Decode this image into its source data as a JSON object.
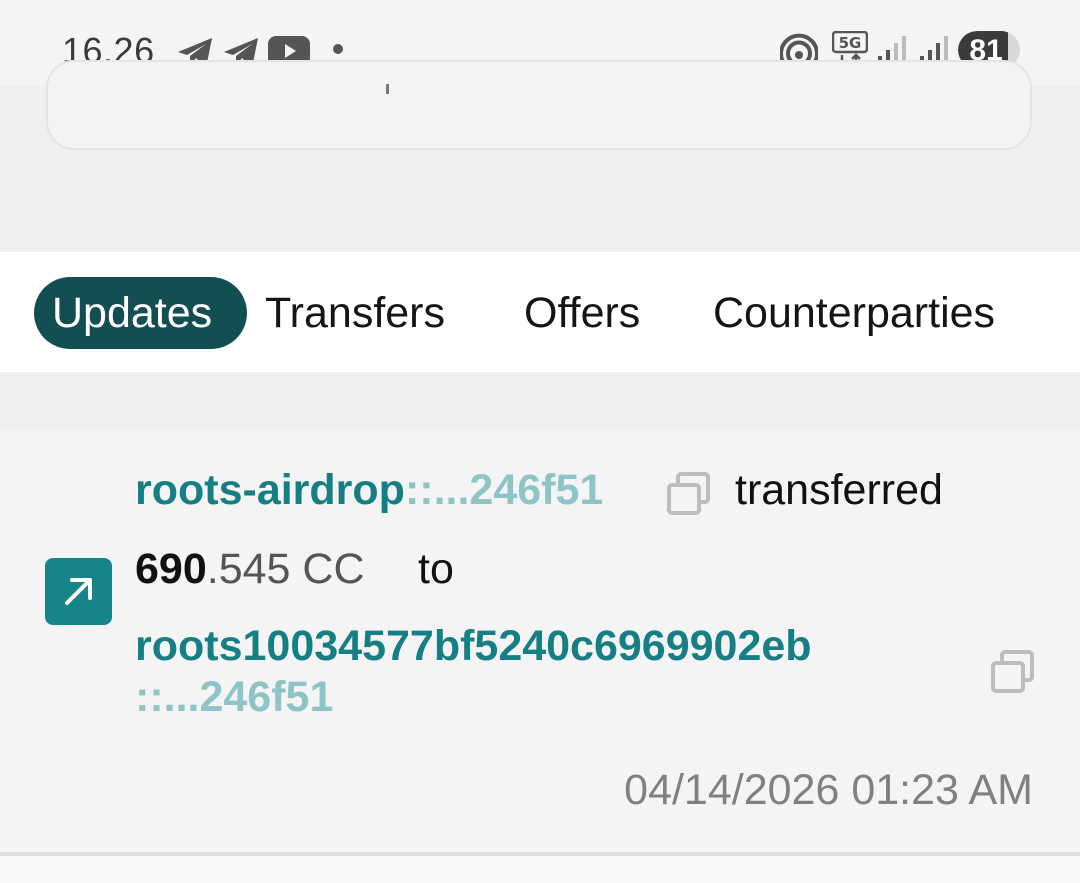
{
  "status_bar": {
    "time": "16.26",
    "battery": "81",
    "network": "5G"
  },
  "tabs": [
    {
      "label": "Updates",
      "active": true
    },
    {
      "label": "Transfers",
      "active": false
    },
    {
      "label": "Offers",
      "active": false
    },
    {
      "label": "Counterparties",
      "active": false
    }
  ],
  "update": {
    "sender_name": "roots-airdrop",
    "sender_suffix": "::...246f51",
    "verb": "transferred",
    "amount_integer": "690",
    "amount_fraction": ".545 CC",
    "preposition": "to",
    "receiver_name": "roots10034577bf5240c6969902eb",
    "receiver_suffix": "::...246f51",
    "timestamp": "04/14/2026 01:23 AM"
  },
  "colors": {
    "accent": "#124e52",
    "party_link": "#157f84",
    "party_suffix": "#8cc4c7",
    "direction_badge": "#158589"
  }
}
